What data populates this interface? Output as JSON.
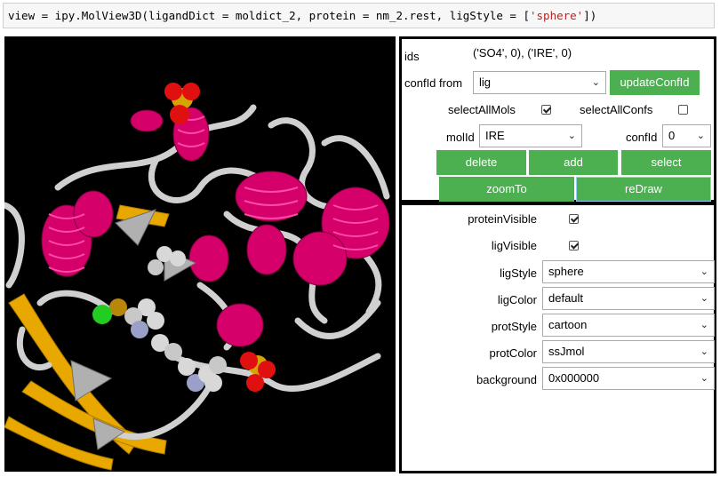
{
  "code_cell": {
    "prefix": "view = ipy.MolView3D(ligandDict = moldict_2, protein = nm_2.rest, ligStyle = [",
    "string": "'sphere'",
    "suffix": "])"
  },
  "panel_top": {
    "ids_label": "ids",
    "ids_value": "('SO4', 0), ('IRE', 0)",
    "confid_from_label": "confId from",
    "confid_from_value": "lig",
    "update_confid_button": "updateConfId",
    "select_all_mols_label": "selectAllMols",
    "select_all_mols_checked": true,
    "select_all_confs_label": "selectAllConfs",
    "select_all_confs_checked": false,
    "molid_label": "molId",
    "molid_value": "IRE",
    "confid_label": "confId",
    "confid_value": "0",
    "delete_button": "delete",
    "add_button": "add",
    "select_button": "select",
    "zoomto_button": "zoomTo",
    "redraw_button": "reDraw"
  },
  "panel_bottom": {
    "protein_visible_label": "proteinVisible",
    "protein_visible_checked": true,
    "lig_visible_label": "ligVisible",
    "lig_visible_checked": true,
    "lig_style_label": "ligStyle",
    "lig_style_value": "sphere",
    "lig_color_label": "ligColor",
    "lig_color_value": "default",
    "prot_style_label": "protStyle",
    "prot_style_value": "cartoon",
    "prot_color_label": "protColor",
    "prot_color_value": "ssJmol",
    "background_label": "background",
    "background_value": "0x000000"
  },
  "colors": {
    "button_green": "#4caf50",
    "helix": "#e0006e",
    "sheet": "#f0b400",
    "coil": "#c8c8c8",
    "viewer_bg": "#000000"
  }
}
